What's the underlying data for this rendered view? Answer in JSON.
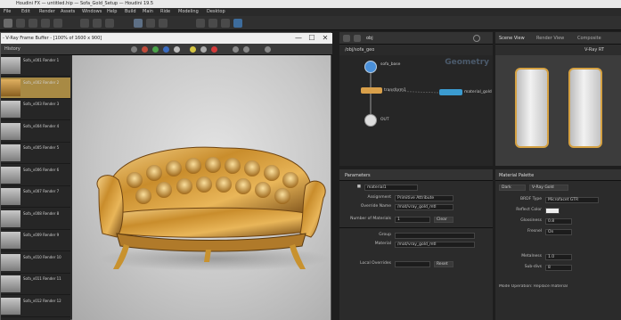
{
  "window": {
    "title": "Houdini FX  —  untitled.hip  —  Sofa_Gold_Setup  —  Houdini 19.5"
  },
  "menubar": {
    "items": [
      "File",
      "Edit",
      "Render",
      "Assets",
      "Windows",
      "Help",
      "Build",
      "Main",
      "Ride",
      "Modeling",
      "Desktop"
    ]
  },
  "render_window": {
    "title": "- V-Ray Frame Buffer - [100% of 1600 x 900]",
    "minimize": "—",
    "maximize": "☐",
    "close": "✕",
    "list_header": "History",
    "thumbnails": [
      {
        "label": "Sofa_v001  Render 1"
      },
      {
        "label": "Sofa_v002  Render 2"
      },
      {
        "label": "Sofa_v003  Render 3"
      },
      {
        "label": "Sofa_v004  Render 4"
      },
      {
        "label": "Sofa_v005  Render 5"
      },
      {
        "label": "Sofa_v006  Render 6"
      },
      {
        "label": "Sofa_v007  Render 7"
      },
      {
        "label": "Sofa_v008  Render 8"
      },
      {
        "label": "Sofa_v009  Render 9"
      },
      {
        "label": "Sofa_v010  Render 10"
      },
      {
        "label": "Sofa_v011  Render 11"
      },
      {
        "label": "Sofa_v012  Render 12"
      }
    ],
    "selected_index": 1
  },
  "network": {
    "tab": "obj",
    "path": "/obj/sofa_geo",
    "watermark": "Geometry",
    "nodes": [
      {
        "label": "sofa_base",
        "color": "#4a90d9"
      },
      {
        "label": "transform1",
        "color": "#d9a04a"
      },
      {
        "label": "material_gold",
        "color": "#3b9bd0"
      },
      {
        "label": "OUT",
        "color": "#dddddd"
      }
    ]
  },
  "viewport": {
    "tabs": [
      "Scene View",
      "Render View",
      "Composite"
    ],
    "badge": "V-Ray RT"
  },
  "parameters": {
    "header": "Parameters",
    "node_name": "material1",
    "rows": [
      {
        "label": "Assignment",
        "value": "Primitive Attribute"
      },
      {
        "label": "Override Name",
        "value": "/mat/vray_gold_mtl"
      },
      {
        "label": "Number of Materials",
        "value": "1"
      },
      {
        "label": "Group",
        "value": ""
      },
      {
        "label": "Material",
        "value": "/mat/vray_gold_mtl"
      },
      {
        "label": "Local Overrides",
        "value": ""
      }
    ],
    "buttons": {
      "clear": "Clear",
      "reset": "Reset"
    }
  },
  "side_panel": {
    "header": "Material Palette",
    "tabs": [
      "Dark",
      "V-Ray Gold"
    ],
    "rows": [
      {
        "label": "BRDF Type",
        "value": "Microfacet GTR"
      },
      {
        "label": "Reflect Color",
        "value": ""
      },
      {
        "label": "Glossiness",
        "value": "0.8"
      },
      {
        "label": "Fresnel",
        "value": "On"
      },
      {
        "label": "Metalness",
        "value": "1.0"
      },
      {
        "label": "Sub-divs",
        "value": "8"
      }
    ],
    "footer": "Mode Operation: Replace material"
  },
  "colors": {
    "gold": "#d5a142",
    "selection": "#a88a44",
    "node_blue": "#4a90d9"
  }
}
